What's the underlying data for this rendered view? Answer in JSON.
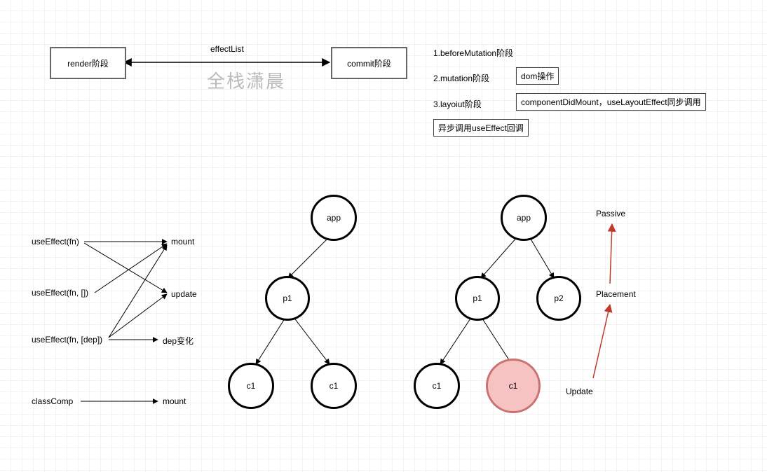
{
  "top": {
    "render_box": "render阶段",
    "commit_box": "commit阶段",
    "effect_list": "effectList",
    "watermark": "全栈潇晨",
    "steps": {
      "s1": "1.beforeMutation阶段",
      "s2": "2.mutation阶段",
      "s3": "3.layoiut阶段",
      "s2_box": "dom操作",
      "s3_box": "componentDidMount，useLayoutEffect同步调用",
      "after_box": "异步调用useEffect回调"
    }
  },
  "hooks": {
    "useEffect_fn": "useEffect(fn)",
    "useEffect_fn_empty": "useEffect(fn, [])",
    "useEffect_fn_dep": "useEffect(fn, [dep])",
    "classComp": "classComp",
    "mount": "mount",
    "update": "update",
    "dep_change": "dep变化",
    "mount2": "mount"
  },
  "tree": {
    "app": "app",
    "p1": "p1",
    "p2": "p2",
    "c1": "c1"
  },
  "tags": {
    "passive": "Passive",
    "placement": "Placement",
    "update": "Update"
  },
  "chart_data": {
    "type": "diagram",
    "title": "React render/commit phases and effect scheduling",
    "phases": {
      "render": "render阶段",
      "commit": "commit阶段",
      "link_label": "effectList"
    },
    "commit_subphases": [
      {
        "name": "1.beforeMutation阶段",
        "note": null
      },
      {
        "name": "2.mutation阶段",
        "note": "dom操作"
      },
      {
        "name": "3.layoiut阶段",
        "note": "componentDidMount，useLayoutEffect同步调用"
      }
    ],
    "after_commit": "异步调用useEffect回调",
    "hook_invocation": [
      {
        "from": "useEffect(fn)",
        "to": [
          "mount",
          "update"
        ]
      },
      {
        "from": "useEffect(fn, [])",
        "to": [
          "mount"
        ]
      },
      {
        "from": "useEffect(fn, [dep])",
        "to": [
          "mount",
          "update",
          "dep变化"
        ]
      },
      {
        "from": "classComp",
        "to": [
          "mount"
        ]
      }
    ],
    "trees": [
      {
        "root": "app",
        "children": [
          {
            "name": "p1",
            "children": [
              "c1",
              "c1"
            ]
          }
        ]
      },
      {
        "root": "app",
        "children": [
          {
            "name": "p1",
            "children": [
              "c1",
              {
                "name": "c1",
                "highlight": true
              }
            ]
          },
          {
            "name": "p2"
          }
        ]
      }
    ],
    "flag_chain": [
      "Update",
      "Placement",
      "Passive"
    ]
  }
}
